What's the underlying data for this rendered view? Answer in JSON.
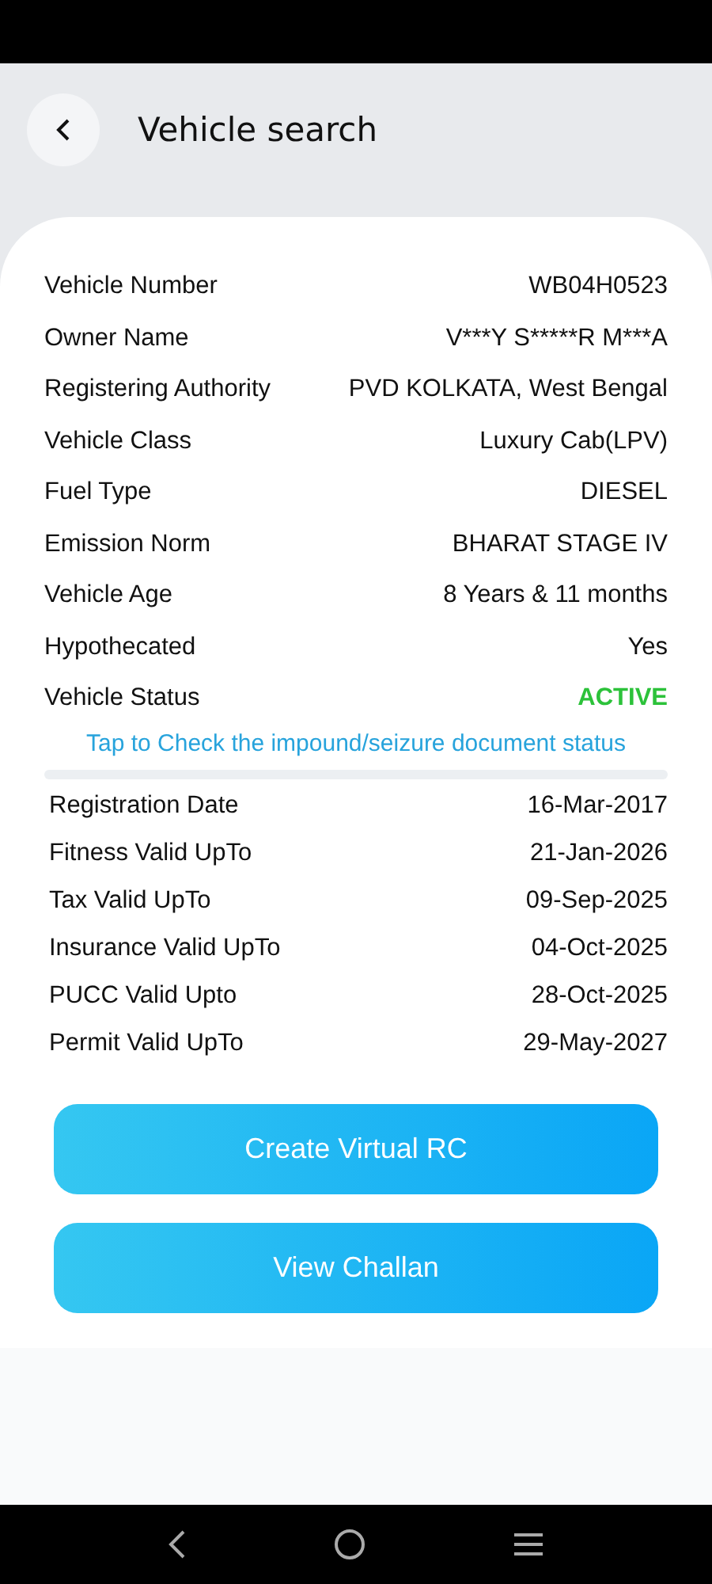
{
  "header": {
    "title": "Vehicle search"
  },
  "details": [
    {
      "label": "Vehicle Number",
      "value": "WB04H0523",
      "kind": "text"
    },
    {
      "label": "Owner Name",
      "value": "V***Y S*****R M***A",
      "kind": "text"
    },
    {
      "label": "Registering Authority",
      "value": "PVD KOLKATA, West Bengal",
      "kind": "text"
    },
    {
      "label": "Vehicle Class",
      "value": "Luxury Cab(LPV)",
      "kind": "text"
    },
    {
      "label": "Fuel Type",
      "value": "DIESEL",
      "kind": "text"
    },
    {
      "label": "Emission Norm",
      "value": "BHARAT STAGE IV",
      "kind": "text"
    },
    {
      "label": "Vehicle Age",
      "value": "8 Years  & 11 months",
      "kind": "text"
    },
    {
      "label": "Hypothecated",
      "value": "Yes",
      "kind": "text"
    },
    {
      "label": "Vehicle Status",
      "value": "ACTIVE",
      "kind": "status"
    }
  ],
  "impound_link": "Tap to Check the impound/seizure document status",
  "validity": [
    {
      "label": "Registration Date",
      "value": "16-Mar-2017"
    },
    {
      "label": "Fitness Valid UpTo",
      "value": "21-Jan-2026"
    },
    {
      "label": "Tax Valid UpTo",
      "value": "09-Sep-2025"
    },
    {
      "label": "Insurance Valid UpTo",
      "value": "04-Oct-2025"
    },
    {
      "label": "PUCC Valid Upto",
      "value": "28-Oct-2025"
    },
    {
      "label": "Permit Valid UpTo",
      "value": "29-May-2027"
    }
  ],
  "buttons": [
    "Create Virtual RC",
    "View Challan"
  ]
}
